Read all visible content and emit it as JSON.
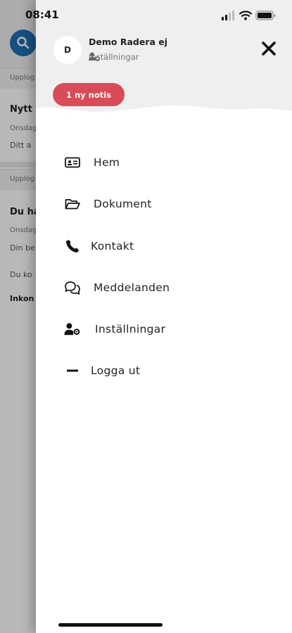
{
  "status_bar": {
    "time": "08:41"
  },
  "background": {
    "rows": [
      {
        "label": "Upplog"
      },
      {
        "title": "Nytt",
        "meta": "Onsdag",
        "snippet": "Ditt a"
      },
      {
        "label": "Upplog"
      },
      {
        "title": "Du ha",
        "meta": "Onsdag",
        "snippet": "Din be",
        "extra": "Du ko",
        "footer": "Inkon"
      }
    ]
  },
  "drawer": {
    "avatar_initial": "D",
    "user_name": "Demo Radera ej",
    "settings_link": "Inställningar",
    "notification_badge": "1 ny notis",
    "menu": [
      {
        "label": "Hem",
        "icon": "id-card-icon"
      },
      {
        "label": "Dokument",
        "icon": "folder-open-icon"
      },
      {
        "label": "Kontakt",
        "icon": "phone-icon"
      },
      {
        "label": "Meddelanden",
        "icon": "chat-icon"
      },
      {
        "label": "Inställningar",
        "icon": "user-gear-icon"
      },
      {
        "label": "Logga ut",
        "icon": "minus-icon"
      }
    ]
  },
  "colors": {
    "badge": "#d84b57",
    "search_button": "#1f6fb5",
    "header_bg": "#efefef",
    "text": "#222222"
  }
}
